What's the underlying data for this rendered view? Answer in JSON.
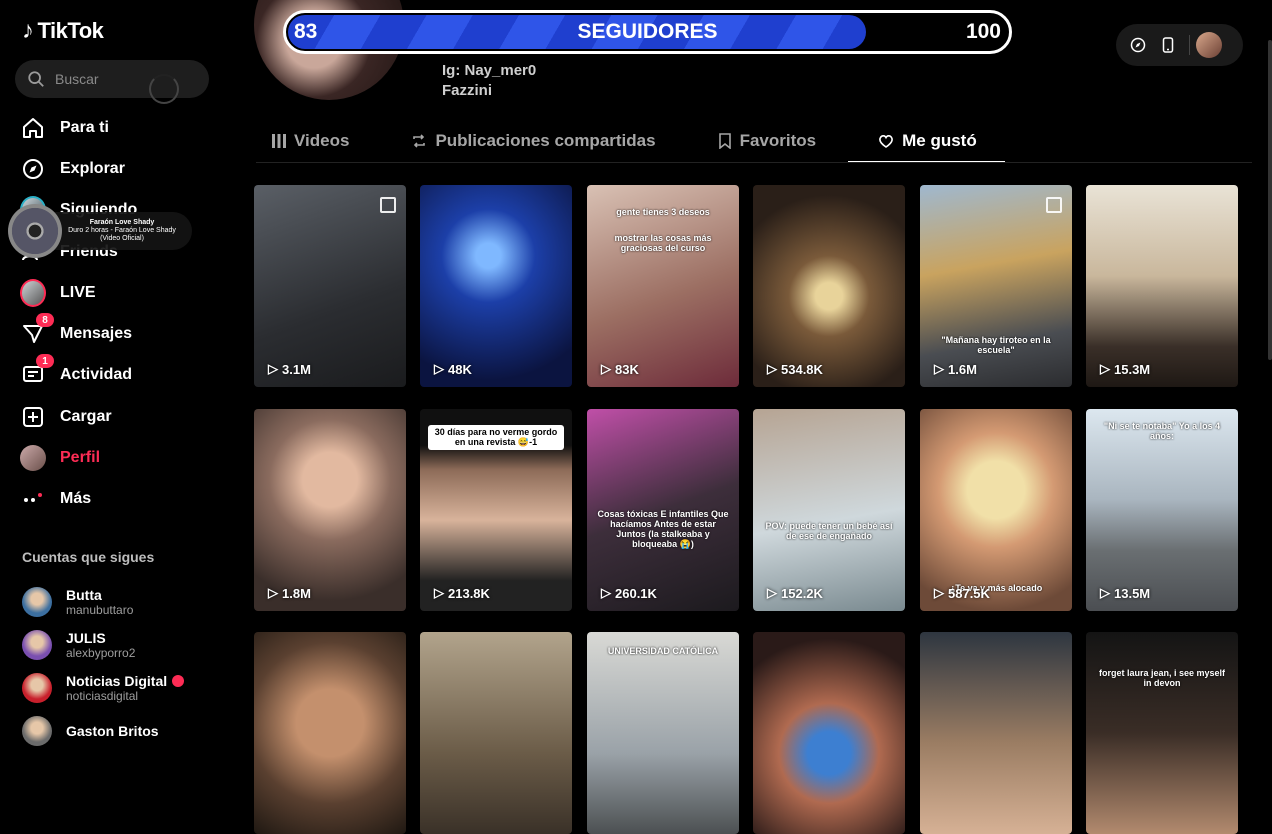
{
  "app": {
    "name": "TikTok"
  },
  "search": {
    "placeholder": "Buscar"
  },
  "nav": [
    {
      "label": "Para ti",
      "icon": "home-icon"
    },
    {
      "label": "Explorar",
      "icon": "compass-icon"
    },
    {
      "label": "Siguiendo",
      "icon": "following-avatar-icon"
    },
    {
      "label": "Friends",
      "icon": "friends-icon"
    },
    {
      "label": "LIVE",
      "icon": "live-avatar-icon"
    },
    {
      "label": "Mensajes",
      "icon": "messages-icon",
      "badge": "8"
    },
    {
      "label": "Actividad",
      "icon": "activity-icon",
      "badge": "1"
    },
    {
      "label": "Cargar",
      "icon": "upload-icon"
    },
    {
      "label": "Perfil",
      "icon": "profile-avatar-icon",
      "active": true
    },
    {
      "label": "Más",
      "icon": "more-icon"
    }
  ],
  "music": {
    "title": "Faraón Love Shady",
    "subtitle": "Duro 2 horas - Faraón Love Shady (Video Oficial)"
  },
  "following": {
    "title": "Cuentas que sigues",
    "accounts": [
      {
        "name": "Butta",
        "handle": "manubuttaro",
        "color": "#3c6fa0"
      },
      {
        "name": "JULIS",
        "handle": "alexbyporro2",
        "color": "#7a4fb0"
      },
      {
        "name": "Noticias Digital",
        "handle": "noticiasdigital",
        "color": "#c8202c",
        "live": true
      },
      {
        "name": "Gaston Britos",
        "handle": "",
        "color": "#6b6b6b"
      }
    ]
  },
  "profile": {
    "bio_line1": "Ig: Nay_mer0",
    "bio_line2": "Fazzini"
  },
  "progress": {
    "current": "83",
    "label": "SEGUIDORES",
    "goal": "100",
    "fraction": 0.83
  },
  "tabs": [
    {
      "label": "Videos",
      "icon": "grid-icon"
    },
    {
      "label": "Publicaciones compartidas",
      "icon": "repost-icon"
    },
    {
      "label": "Favoritos",
      "icon": "bookmark-icon"
    },
    {
      "label": "Me gustó",
      "icon": "heart-icon",
      "active": true
    }
  ],
  "videos": [
    {
      "views": "3.1M",
      "bg": "linear-gradient(160deg,#5a5f66,#2b2d31 60%,#1a1b1d)",
      "stack": true
    },
    {
      "views": "48K",
      "bg": "radial-gradient(circle at 45% 35%,#7fb8ff 0 8%,#1c3fa8 30%,#0b1440 80%)"
    },
    {
      "views": "83K",
      "bg": "linear-gradient(160deg,#d9c1b4,#9c6f63 55%,#6d2b3a)",
      "cap": "gente tienes 3 deseos",
      "cap2": "mostrar las cosas más graciosas del curso",
      "capTop": 22
    },
    {
      "views": "534.8K",
      "bg": "radial-gradient(circle at 50% 55%,#e8d39a 0 10%,#7a5a3a 30%,#2a1f18 75%)"
    },
    {
      "views": "1.6M",
      "bg": "linear-gradient(170deg,#9fb8cf,#c9a35f 40%,#4a4d52 75%,#2b2c2f)",
      "cap": "\"Mañana hay tiroteo en la escuela\"",
      "capTop": 150,
      "stack": true
    },
    {
      "views": "15.3M",
      "bg": "linear-gradient(180deg,#e9e3d6,#c9b79c 45%,#3a2f28 80%,#1e1814)"
    },
    {
      "views": "1.8M",
      "bg": "radial-gradient(circle at 50% 35%,#e2b9a0 0 18%,#8a6b5e 40%,#3a2e2a 80%)"
    },
    {
      "views": "213.8K",
      "bg": "linear-gradient(180deg,#101010 0 18%,#8d6b58 30%,#d8b39b 55%,#222 85%)",
      "capbox": "30 días para no verme gordo en una revista 😅-1",
      "capTop": 16
    },
    {
      "views": "260.1K",
      "bg": "linear-gradient(160deg,#c04fa8,#3d2e3b 50%,#1c1a1e)",
      "cap": "Cosas tóxicas E infantiles Que hacíamos Antes de estar Juntos (la stalkeaba y bloqueaba 😭)",
      "capTop": 100
    },
    {
      "views": "152.2K",
      "bg": "linear-gradient(170deg,#b6a493,#cfd8dc 55%,#7a8a90)",
      "cap": "POV: puede tener un bebé así de ese de engañado",
      "capTop": 112
    },
    {
      "views": "587.5K",
      "bg": "radial-gradient(circle at 50% 40%,#f1e0a8 0 20%,#d49a73 40%,#6d4a38 85%)",
      "cap": "¿Te va y más alocado",
      "capTop": 174
    },
    {
      "views": "13.5M",
      "bg": "linear-gradient(180deg,#dce7ef,#a9b5bf 45%,#6a6f72 70%,#4b4e52)",
      "cap": "\"Ni se te notaba\" Yo a los 4 años:",
      "capTop": 12
    },
    {
      "views": "",
      "bg": "radial-gradient(circle at 50% 45%,#c4906d 0 25%,#5a4030 60%,#1f1812)"
    },
    {
      "views": "",
      "bg": "linear-gradient(180deg,#b2a48c,#6b5c48 60%,#3a3128)"
    },
    {
      "views": "",
      "bg": "linear-gradient(180deg,#d9d9d5,#9aa2a8 60%,#4c5052)",
      "cap": "UNIVERSIDAD CATÓLICA",
      "capTop": 14
    },
    {
      "views": "",
      "bg": "radial-gradient(circle at 50% 60%,#3d7fd1 0 15%,#b06a50 35%,#2a1a18 80%)"
    },
    {
      "views": "",
      "bg": "linear-gradient(180deg,#2e3640,#9b7d63 55%,#d6b195)"
    },
    {
      "views": "",
      "bg": "linear-gradient(180deg,#141414,#3a2d26 50%,#b28a6e)",
      "cap": "forget laura jean, i see myself in devon",
      "capTop": 36
    }
  ]
}
